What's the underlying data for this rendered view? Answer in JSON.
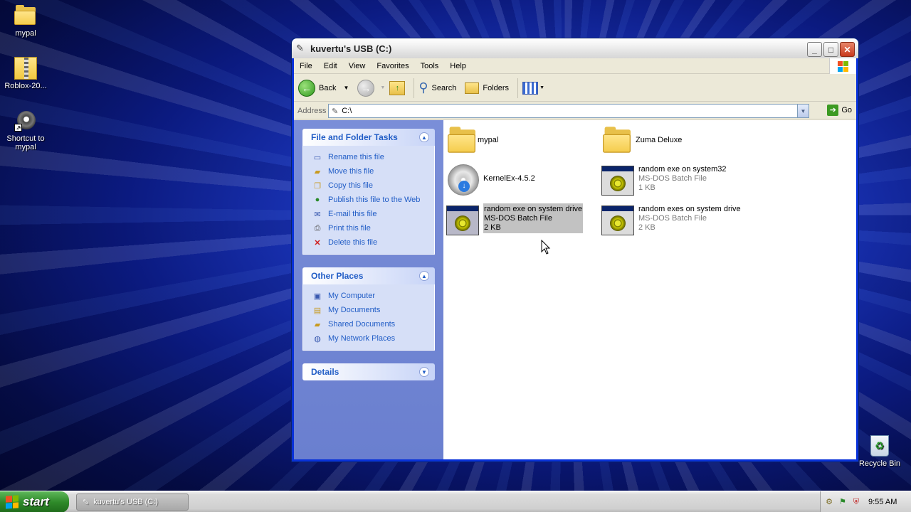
{
  "desktop": {
    "icons": [
      {
        "label": "mypal"
      },
      {
        "label": "Roblox-20..."
      },
      {
        "label": "Shortcut to mypal"
      }
    ],
    "recycle_bin": "Recycle Bin"
  },
  "window": {
    "title": "kuvertu's USB (C:)",
    "menu": [
      "File",
      "Edit",
      "View",
      "Favorites",
      "Tools",
      "Help"
    ],
    "toolbar": {
      "back": "Back",
      "search": "Search",
      "folders": "Folders"
    },
    "address": {
      "label": "Address",
      "value": "C:\\",
      "go": "Go"
    },
    "tasks_panel": {
      "title": "File and Folder Tasks",
      "items": [
        "Rename this file",
        "Move this file",
        "Copy this file",
        "Publish this file to the Web",
        "E-mail this file",
        "Print this file",
        "Delete this file"
      ]
    },
    "places_panel": {
      "title": "Other Places",
      "items": [
        "My Computer",
        "My Documents",
        "Shared Documents",
        "My Network Places"
      ]
    },
    "details_panel": {
      "title": "Details"
    },
    "files": [
      {
        "name": "mypal",
        "type": "",
        "size": ""
      },
      {
        "name": "Zuma Deluxe",
        "type": "",
        "size": ""
      },
      {
        "name": "KernelEx-4.5.2",
        "type": "",
        "size": ""
      },
      {
        "name": "random exe on system32",
        "type": "MS-DOS Batch File",
        "size": "1 KB"
      },
      {
        "name": "random exe on system drive",
        "type": "MS-DOS Batch File",
        "size": "2 KB"
      },
      {
        "name": "random exes on system drive",
        "type": "MS-DOS Batch File",
        "size": "2 KB"
      }
    ]
  },
  "taskbar": {
    "start": "start",
    "task": "kuvertu's USB (C:)",
    "clock": "9:55 AM"
  }
}
